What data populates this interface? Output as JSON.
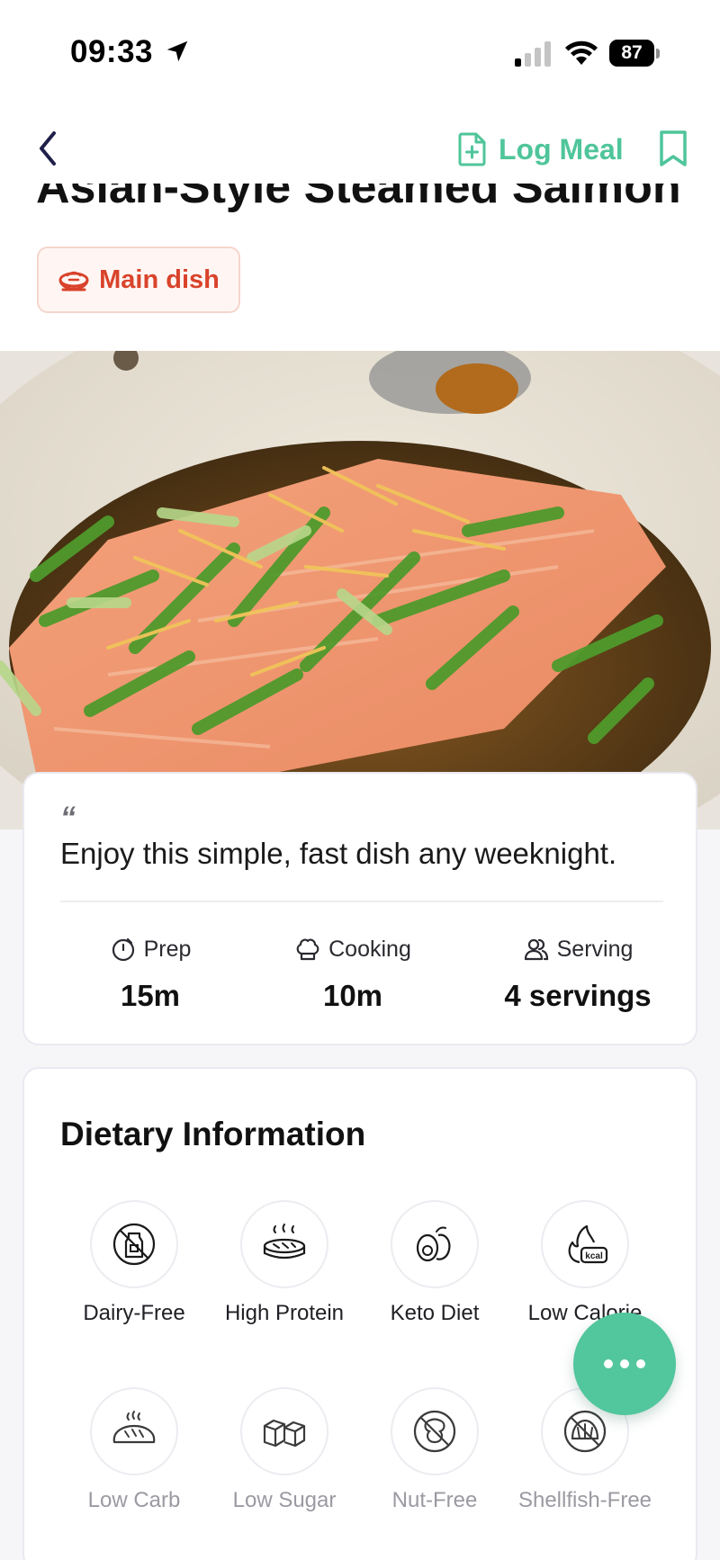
{
  "status_bar": {
    "time": "09:33",
    "battery": "87"
  },
  "header": {
    "log_meal_label": "Log Meal"
  },
  "recipe": {
    "title": "Asian-Style Steamed Salmon",
    "category": "Main dish",
    "quote": "Enjoy this simple, fast dish any weeknight.",
    "stats": {
      "prep_label": "Prep",
      "prep_value": "15m",
      "cooking_label": "Cooking",
      "cooking_value": "10m",
      "serving_label": "Serving",
      "serving_value": "4 servings"
    }
  },
  "dietary": {
    "title": "Dietary Information",
    "items": [
      {
        "label": "Dairy-Free",
        "icon": "dairy-free-icon"
      },
      {
        "label": "High Protein",
        "icon": "steak-icon"
      },
      {
        "label": "Keto Diet",
        "icon": "avocado-icon"
      },
      {
        "label": "Low Calorie",
        "icon": "kcal-flame-icon"
      },
      {
        "label": "Low Carb",
        "icon": "bread-icon"
      },
      {
        "label": "Low Sugar",
        "icon": "sugar-cubes-icon"
      },
      {
        "label": "Nut-Free",
        "icon": "nut-free-icon"
      },
      {
        "label": "Shellfish-Free",
        "icon": "shellfish-free-icon"
      }
    ]
  },
  "colors": {
    "accent_green": "#52c69d",
    "badge_red": "#d9432b"
  }
}
